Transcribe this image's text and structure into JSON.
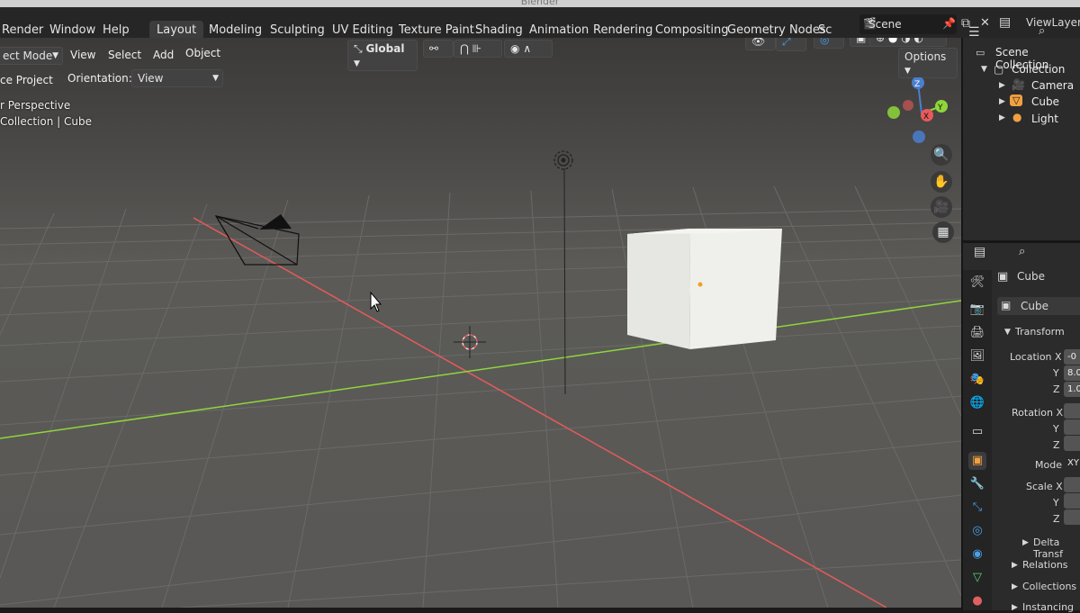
{
  "window": {
    "title": "Blender"
  },
  "menus": [
    "Render",
    "Window",
    "Help"
  ],
  "workspaces": [
    "Layout",
    "Modeling",
    "Sculpting",
    "UV Editing",
    "Texture Paint",
    "Shading",
    "Animation",
    "Rendering",
    "Compositing",
    "Geometry Nodes",
    "Sc"
  ],
  "active_workspace": "Layout",
  "scene": {
    "name": "Scene",
    "view_layer": "ViewLayer"
  },
  "viewport": {
    "mode": "ect Mode",
    "menus": [
      "View",
      "Select",
      "Add",
      "Object"
    ],
    "transform_orientation": "Global",
    "snap_label": "ce Project",
    "orientation_label": "Orientation:",
    "orientation_value": "View",
    "options_label": "Options",
    "overlay_text_1": "r Perspective",
    "overlay_text_2": "Collection | Cube",
    "gizmo": {
      "z": "Z",
      "y": "Y",
      "x": "X"
    }
  },
  "outliner": {
    "root": "Scene Collection",
    "collection": "Collection",
    "items": [
      "Camera",
      "Cube",
      "Light"
    ]
  },
  "properties": {
    "object_name": "Cube",
    "data_name": "Cube",
    "panel_transform": "Transform",
    "location_label": "Location X",
    "y_label": "Y",
    "z_label": "Z",
    "rotation_label": "Rotation X",
    "mode_label": "Mode",
    "mode_value": "XY",
    "scale_label": "Scale X",
    "loc_x": "-0",
    "loc_y": "8.0",
    "loc_z": "1.0",
    "delta_transform": "Delta Transf",
    "relations": "Relations",
    "collections": "Collections",
    "instancing": "Instancing"
  },
  "colors": {
    "x_axis": "#e85a5a",
    "y_axis": "#8fd63a",
    "accent": "#4a7fd0"
  }
}
